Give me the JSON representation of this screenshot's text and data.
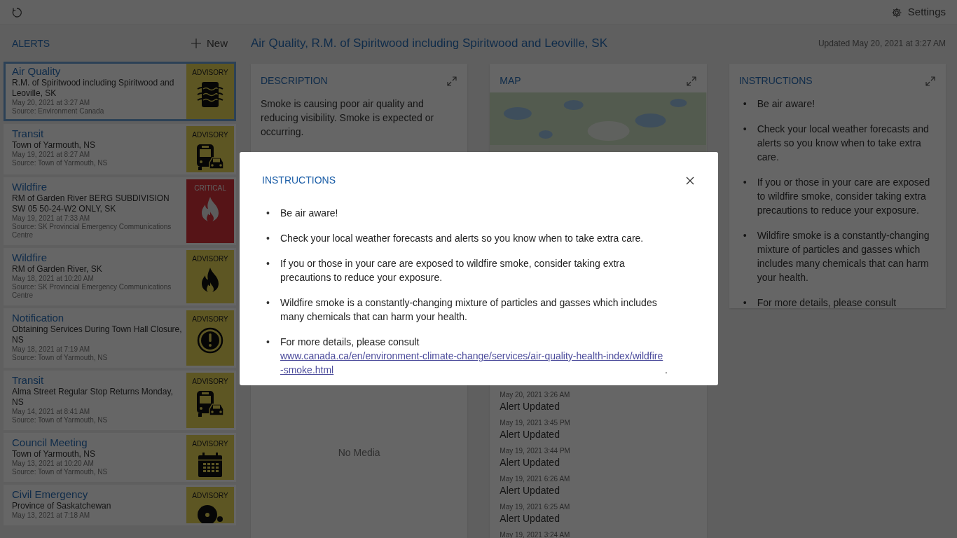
{
  "top_bar": {
    "settings_label": "Settings"
  },
  "sidebar": {
    "title": "ALERTS",
    "new_label": "New",
    "alerts": [
      {
        "title": "Air Quality",
        "area": "R.M. of Spiritwood including Spiritwood and Leoville, SK",
        "date": "May 20, 2021 at 3:27 AM",
        "source": "Source: Environment Canada",
        "critical": false,
        "label": "ADVISORY",
        "kind": "air",
        "selected": true
      },
      {
        "title": "Transit",
        "area": "Town of Yarmouth, NS",
        "date": "May 19, 2021 at 8:27 AM",
        "source": "Source: Town of Yarmouth, NS",
        "critical": false,
        "label": "ADVISORY",
        "kind": "bus",
        "selected": false
      },
      {
        "title": "Wildfire",
        "area": "RM of Garden River BERG SUBDIVISION SW 05 50-24-W2 ONLY, SK",
        "date": "May 19, 2021 at 7:33 AM",
        "source": "Source: SK Provincial Emergency Communications Centre",
        "critical": true,
        "label": "CRITICAL",
        "kind": "fire",
        "selected": false
      },
      {
        "title": "Wildfire",
        "area": "RM of Garden River, SK",
        "date": "May 18, 2021 at 10:20 AM",
        "source": "Source: SK Provincial Emergency Communications Centre",
        "critical": false,
        "label": "ADVISORY",
        "kind": "fire",
        "selected": false
      },
      {
        "title": "Notification",
        "area": "Obtaining Services During Town Hall Closure, NS",
        "date": "May 18, 2021 at 7:19 AM",
        "source": "Source: Town of Yarmouth, NS",
        "critical": false,
        "label": "ADVISORY",
        "kind": "exclamation",
        "selected": false
      },
      {
        "title": "Transit",
        "area": "Alma Street Regular Stop Returns Monday, NS",
        "date": "May 14, 2021 at 8:41 AM",
        "source": "Source: Town of Yarmouth, NS",
        "critical": false,
        "label": "ADVISORY",
        "kind": "bus",
        "selected": false
      },
      {
        "title": "Council Meeting",
        "area": "Town of Yarmouth, NS",
        "date": "May 13, 2021 at 10:20 AM",
        "source": "Source: Town of Yarmouth, NS",
        "critical": false,
        "label": "ADVISORY",
        "kind": "calendar",
        "selected": false
      },
      {
        "title": "Civil Emergency",
        "area": "Province of Saskatchewan",
        "date": "May 13, 2021 at 7:18 AM",
        "critical": false,
        "label": "ADVISORY",
        "kind": "siren",
        "selected": false
      }
    ]
  },
  "detail": {
    "title": "Air Quality, R.M. of Spiritwood including Spiritwood and Leoville, SK",
    "updated": "Updated May 20, 2021 at 3:27 AM",
    "description": {
      "title": "DESCRIPTION",
      "text": "Smoke is causing poor air quality and reducing visibility. Smoke is expected or occurring.",
      "media_text": "No Media"
    },
    "map": {
      "title": "MAP",
      "history": [
        {
          "date": "May 20, 2021 3:26 AM",
          "event": "Alert Updated"
        },
        {
          "date": "May 19, 2021 3:45 PM",
          "event": "Alert Updated"
        },
        {
          "date": "May 19, 2021 3:44 PM",
          "event": "Alert Updated"
        },
        {
          "date": "May 19, 2021 6:26 AM",
          "event": "Alert Updated"
        },
        {
          "date": "May 19, 2021 6:25 AM",
          "event": "Alert Updated"
        },
        {
          "date": "May 19, 2021 3:24 AM"
        }
      ]
    },
    "instructions": {
      "title": "INSTRUCTIONS",
      "items": [
        {
          "marker": "•",
          "text": "Be air aware!"
        },
        {
          "marker": "•",
          "text": "Check your local weather forecasts and alerts so you know when to take extra care."
        },
        {
          "marker": "•",
          "text": "If you or those in your care are exposed to wildfire smoke, consider taking extra precautions to reduce your exposure."
        },
        {
          "marker": "•",
          "text": "Wildfire smoke is a constantly-changing mixture of particles and gasses which includes many chemicals that can harm your health."
        },
        {
          "marker": "•",
          "text": "For more details, please consult"
        }
      ]
    }
  },
  "modal": {
    "title": "INSTRUCTIONS",
    "items": [
      {
        "marker": "•",
        "text": "Be air aware!"
      },
      {
        "marker": "•",
        "text": "Check your local weather forecasts and alerts so you know when to take extra care."
      },
      {
        "marker": "•",
        "text": "If you or those in your care are exposed to wildfire smoke, consider taking extra precautions to reduce your exposure."
      },
      {
        "marker": "•",
        "text": "Wildfire smoke is a constantly-changing mixture of particles and gasses which includes many chemicals that can harm your health."
      },
      {
        "marker": "•",
        "text": "For more details, please consult",
        "link": "www.canada.ca/en/environment-climate-change/services/air-quality-health-index/wildfire-smoke.html",
        "after": "."
      }
    ]
  }
}
